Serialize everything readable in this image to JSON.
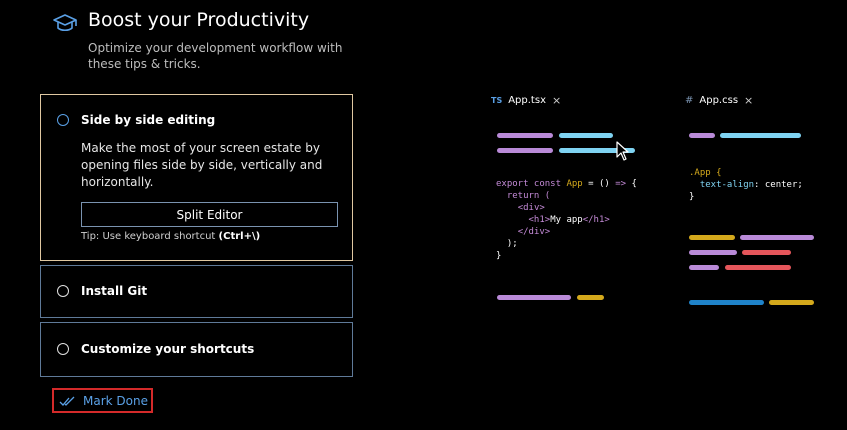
{
  "header": {
    "title": "Boost your Productivity",
    "subtitle": "Optimize your development workflow with these tips & tricks.",
    "icon": "graduation-cap-icon"
  },
  "steps": [
    {
      "title": "Side by side editing",
      "description": "Make the most of your screen estate by opening files side by side, vertically and horizontally.",
      "button_label": "Split Editor",
      "tip_prefix": "Tip: Use keyboard shortcut ",
      "tip_shortcut": "(Ctrl+\\)",
      "expanded": true
    },
    {
      "title": "Install Git",
      "expanded": false
    },
    {
      "title": "Customize your shortcuts",
      "expanded": false
    }
  ],
  "footer": {
    "mark_done_label": "Mark Done",
    "icon": "double-check-icon"
  },
  "preview": {
    "left_tab": {
      "lang": "TS",
      "name": "App.tsx",
      "close": "×"
    },
    "right_tab": {
      "lang": "#",
      "name": "App.css",
      "close": "×"
    },
    "tsx_lines": {
      "l1_a": "export const ",
      "l1_b": "App",
      "l1_c": " = () ",
      "l1_d": "=>",
      "l1_e": " {",
      "l2": "  return (",
      "l3": "<div>",
      "l4_a": "<h1>",
      "l4_b": "My app",
      "l4_c": "</h1>",
      "l5": "</div>",
      "l6": "  );",
      "l7": "}"
    },
    "css_lines": {
      "l1": ".App {",
      "l2_a": "text-align",
      "l2_b": ": center;",
      "l3": "}"
    }
  },
  "colors": {
    "accent": "#5aa0e6",
    "purple": "#b98ad8",
    "cyan": "#7fd3f2",
    "yellow": "#d4a91c",
    "red": "#e5565b",
    "blue": "#1f83c9",
    "highlight": "#d42a2a"
  }
}
